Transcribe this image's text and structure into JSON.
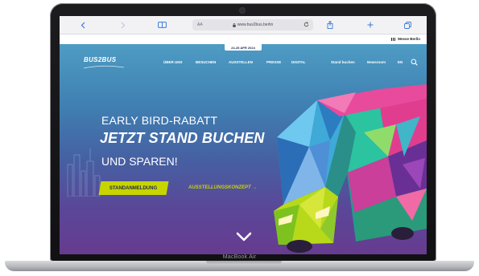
{
  "device": {
    "model_label": "MacBook Air"
  },
  "browser": {
    "address_aa": "AA",
    "url": "www.bus2bus.berlin"
  },
  "site": {
    "partner_logo": "Messe Berlin",
    "date_badge": "24-25 APR 2024",
    "brand": "BUS2BUS",
    "nav": {
      "about": "ÜBER UNS",
      "visit": "BESUCHEN",
      "exhibit": "AUSSTELLEN",
      "press": "PRESSE",
      "digital": "DIGITAL",
      "book_stand": "Stand buchen",
      "newsroom": "Newsroom",
      "language": "EN"
    },
    "hero": {
      "line1": "EARLY BIRD-RABATT",
      "line2": "JETZT STAND BUCHEN",
      "line3": "UND SPAREN!",
      "cta_primary": "STANDANMELDUNG",
      "cta_secondary": "AUSSTELLUNGSKONZEPT →"
    }
  },
  "colors": {
    "accent": "#c7d400",
    "navy": "#1d2b4f",
    "hero_top": "#4e9cc4",
    "hero_bottom": "#673b8f"
  },
  "icons": {
    "back": "chevron-left-icon",
    "forward": "chevron-right-icon",
    "reader": "book-icon",
    "lock": "lock-icon",
    "reload": "reload-icon",
    "share": "share-icon",
    "new_tab": "plus-icon",
    "tabs": "tabs-icon",
    "search": "search-icon",
    "scroll": "chevron-down-icon"
  }
}
